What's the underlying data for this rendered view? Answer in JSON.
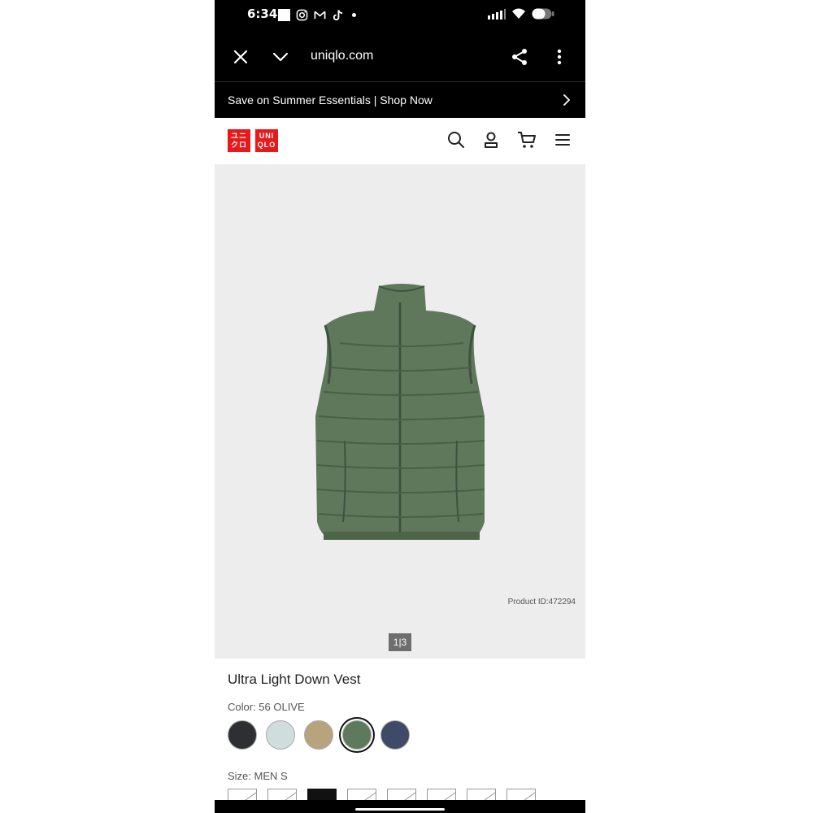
{
  "status": {
    "time": "6:34"
  },
  "browser": {
    "url": "uniqlo.com"
  },
  "promo": {
    "text": "Save on Summer Essentials | Shop Now"
  },
  "logo": {
    "line1": "ユニ",
    "line2": "クロ",
    "line3": "UNI",
    "line4": "QLO"
  },
  "product": {
    "product_id": "Product ID:472294",
    "image_index": "1|3",
    "title": "Ultra Light Down Vest",
    "color_label": "Color: 56 OLIVE",
    "colors": [
      "#2e2f33",
      "#cfdedd",
      "#b7a47c",
      "#5e7a5c",
      "#3e4a68"
    ],
    "selected_color_index": 3,
    "size_label": "Size: MEN S",
    "size_count": 8,
    "selected_size_index": 2
  },
  "icons": {
    "close": "close-icon",
    "chevron": "chevron-down-icon",
    "share": "share-icon",
    "more": "more-vertical-icon",
    "search": "search-icon",
    "account": "account-icon",
    "cart": "cart-icon",
    "menu": "menu-icon"
  }
}
